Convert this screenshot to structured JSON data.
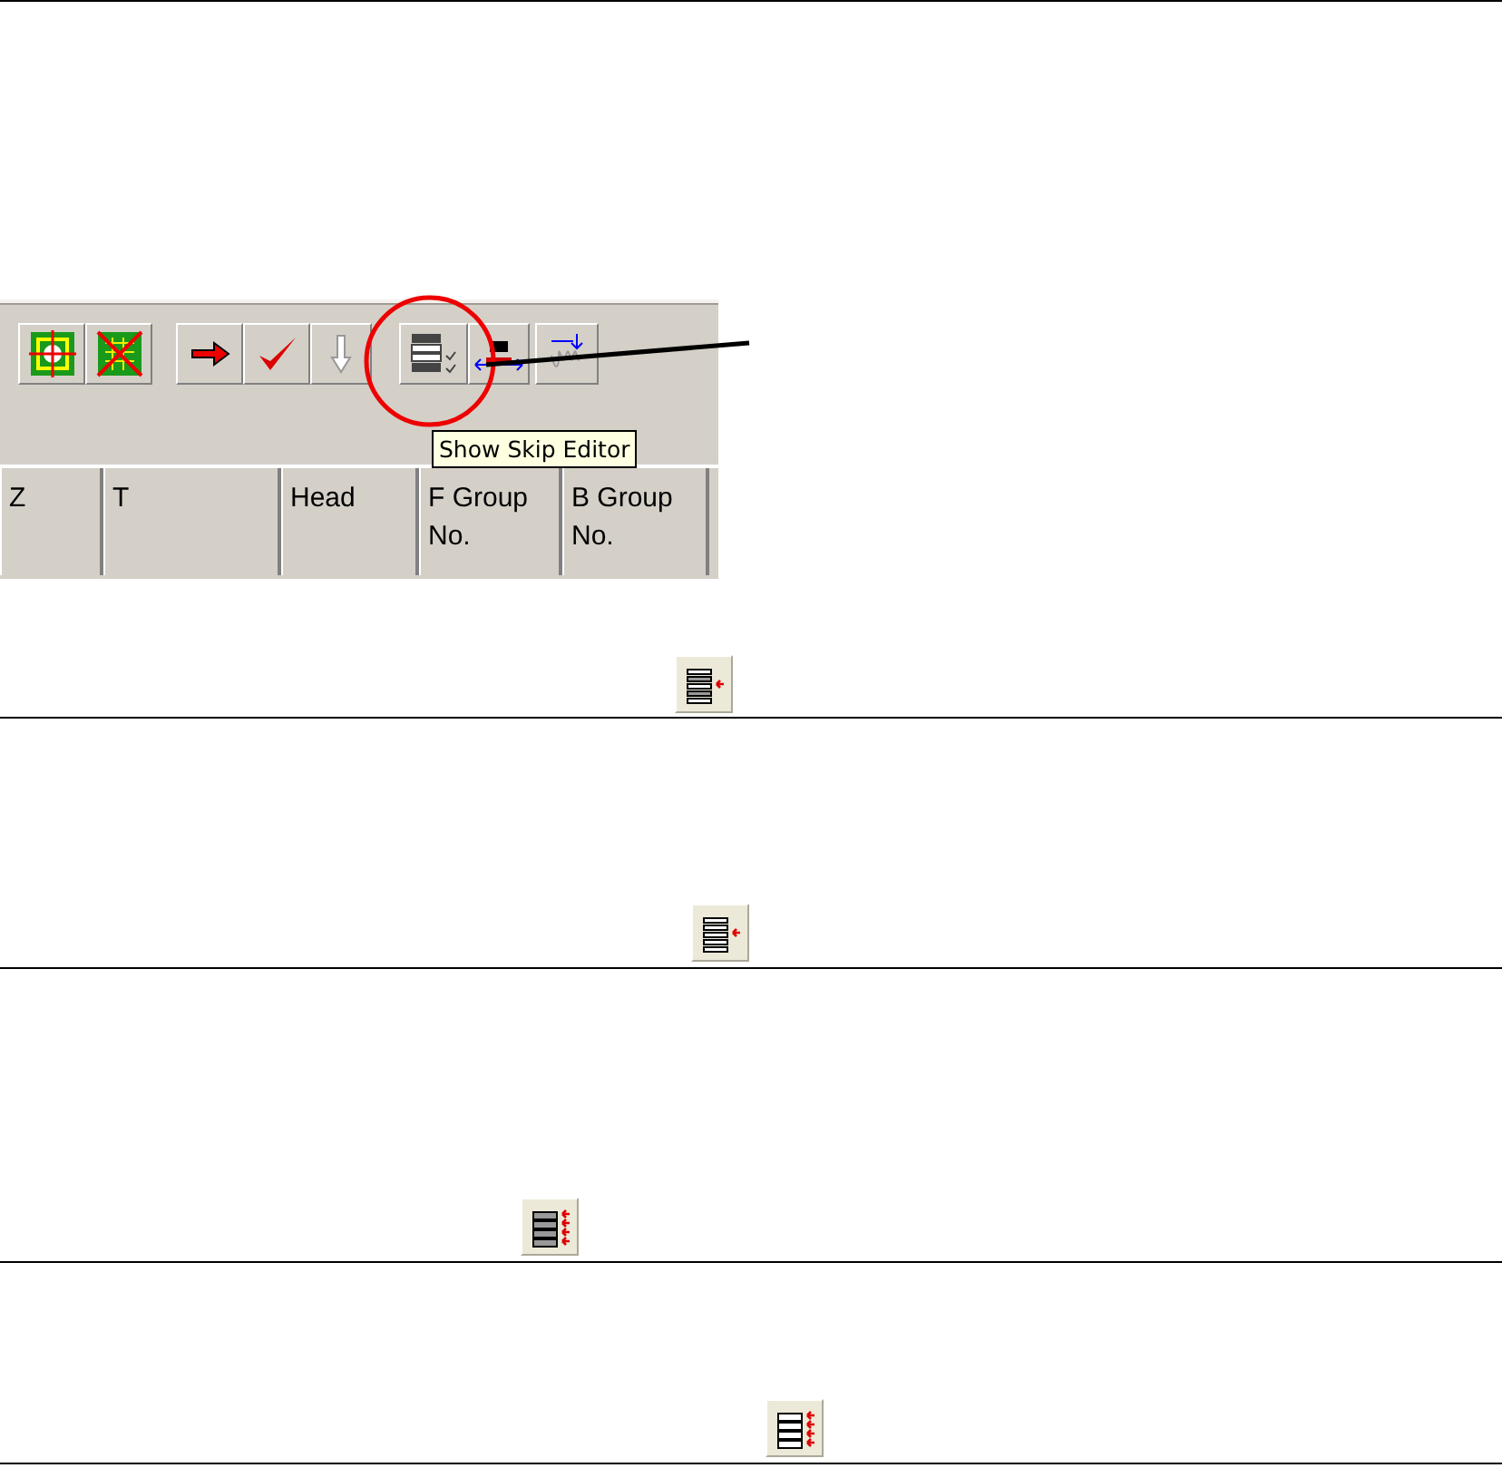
{
  "screenshot": {
    "tooltip": "Show Skip Editor",
    "columns": [
      "Z",
      "T",
      "Head",
      "F Group\nNo.",
      "B Group\nNo."
    ]
  },
  "sections": [
    {
      "kind": "single"
    },
    {
      "kind": "outline"
    },
    {
      "kind": "all"
    },
    {
      "kind": "allout"
    }
  ]
}
